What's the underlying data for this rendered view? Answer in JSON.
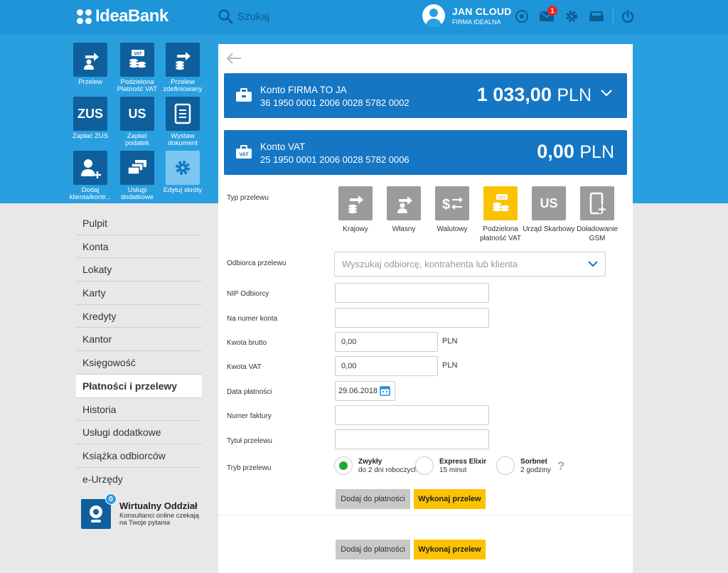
{
  "header": {
    "logo_text": "IdeaBank",
    "search_label": "Szukaj",
    "user_name": "JAN CLOUD",
    "user_company": "FIRMA IDEALNA",
    "messages_badge": "1"
  },
  "shortcuts": [
    {
      "label": "Przelew",
      "icon": "transfer-person-icon",
      "tile_text": ""
    },
    {
      "label": "Podzielona Płatność VAT",
      "icon": "vat-split-icon",
      "tile_text": ""
    },
    {
      "label": "Przelew zdefiniowany",
      "icon": "defined-transfer-icon",
      "tile_text": ""
    },
    {
      "label": "Zapłać ZUS",
      "icon": "zus-icon",
      "tile_text": "ZUS"
    },
    {
      "label": "Zapłać podatek",
      "icon": "us-tax-icon",
      "tile_text": "US"
    },
    {
      "label": "Wystaw dokument",
      "icon": "document-icon",
      "tile_text": ""
    },
    {
      "label": "Dodaj klienta/kontr...",
      "icon": "add-user-icon",
      "tile_text": ""
    },
    {
      "label": "Usługi dodatkowe",
      "icon": "stack-icon",
      "tile_text": ""
    },
    {
      "label": "Edytuj skróty",
      "icon": "gear-icon",
      "tile_text": ""
    }
  ],
  "nav": [
    "Pulpit",
    "Konta",
    "Lokaty",
    "Karty",
    "Kredyty",
    "Kantor",
    "Księgowość",
    "Płatności i przelewy",
    "Historia",
    "Usługi dodatkowe",
    "Książka odbiorców",
    "e-Urzędy"
  ],
  "nav_active_index": 7,
  "virtual_branch": {
    "badge": "0",
    "title": "Wirtualny Oddział",
    "subtitle": "Konsultanci online czekają na Twoje pytania"
  },
  "accounts": [
    {
      "name": "Konto FIRMA TO JA",
      "number": "36 1950 0001 2006 0028 5782 0002",
      "balance": "1 033,00",
      "currency": "PLN"
    },
    {
      "name": "Konto VAT",
      "number": "25 1950 0001 2006 0028 5782 0006",
      "balance": "0,00",
      "currency": "PLN"
    }
  ],
  "form": {
    "transfer_type_label": "Typ przelewu",
    "transfer_types": [
      {
        "label": "Krajowy",
        "tile_text": ""
      },
      {
        "label": "Własny",
        "tile_text": ""
      },
      {
        "label": "Walutowy",
        "tile_text": ""
      },
      {
        "label": "Podzielona płatność VAT",
        "tile_text": ""
      },
      {
        "label": "Urząd Skarbowy",
        "tile_text": "US"
      },
      {
        "label": "Doładowanie GSM",
        "tile_text": ""
      }
    ],
    "selected_type_index": 3,
    "recipient_label": "Odbiorca przelewu",
    "recipient_placeholder": "Wyszukaj odbiorcę, kontrahenta lub klienta",
    "nip_label": "NIP Odbiorcy",
    "nip_value": "",
    "account_label": "Na numer konta",
    "account_value": "",
    "gross_label": "Kwota brutto",
    "gross_value": "0,00",
    "gross_currency": "PLN",
    "vat_label": "Kwota VAT",
    "vat_value": "0,00",
    "vat_currency": "PLN",
    "date_label": "Data płatności",
    "date_value": "29.06.2018",
    "invoice_label": "Numer faktury",
    "invoice_value": "",
    "title_label": "Tytuł przelewu",
    "title_value": "",
    "mode_label": "Tryb przelewu",
    "modes": [
      {
        "title": "Zwykły",
        "sub": "do 2 dni roboczych",
        "selected": true
      },
      {
        "title": "Express Elixir",
        "sub": "15 minut",
        "selected": false
      },
      {
        "title": "Sorbnet",
        "sub": "2 godziny",
        "selected": false
      }
    ],
    "help_mark": "?",
    "add_button": "Dodaj do płatności",
    "execute_button": "Wykonaj przelew"
  }
}
